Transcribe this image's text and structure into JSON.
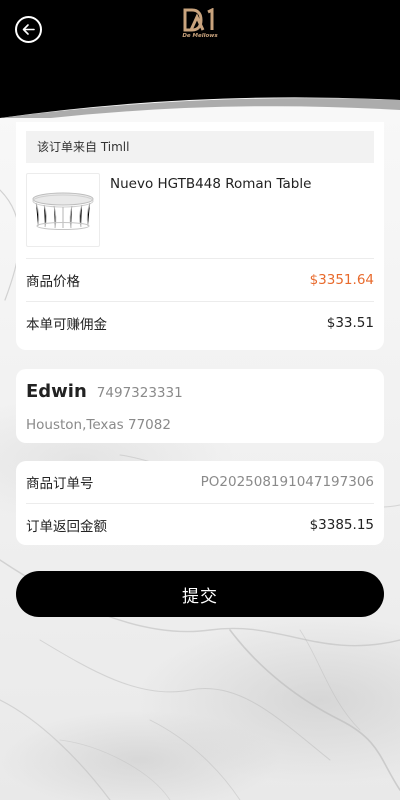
{
  "header": {
    "logo_text": "De Mellows",
    "logo_monogram": "DM",
    "back_icon": "back-arrow-icon",
    "colors": {
      "bar": "#000000",
      "logo": "#c9a37d"
    }
  },
  "order": {
    "source_label": "该订单来自 Timll",
    "product_name": "Nuevo HGTB448 Roman Table",
    "price_label": "商品价格",
    "price_value": "$3351.64",
    "commission_label": "本单可赚佣金",
    "commission_value": "$33.51",
    "price_color": "#e86a2c"
  },
  "address": {
    "name": "Edwin",
    "phone": "7497323331",
    "location": "Houston,Texas 77082"
  },
  "order_info": {
    "order_no_label": "商品订单号",
    "order_no_value": "PO202508191047197306",
    "refund_label": "订单返回金额",
    "refund_value": "$3385.15"
  },
  "actions": {
    "submit_label": "提交"
  }
}
